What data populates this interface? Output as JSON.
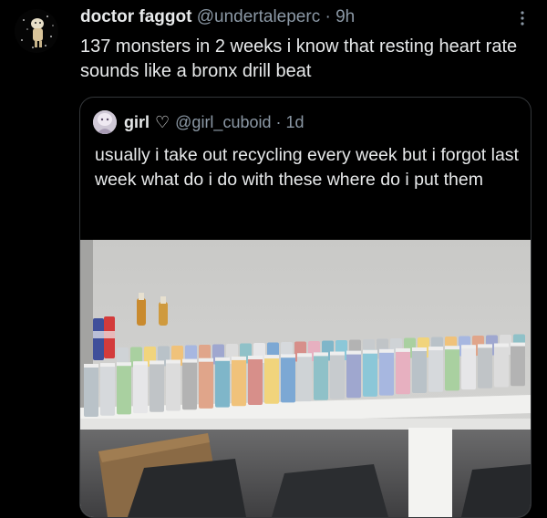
{
  "tweet": {
    "display_name": "doctor faggot",
    "handle": "@undertaleperc",
    "separator": "·",
    "time": "9h",
    "text": "137 monsters in 2 weeks i know that resting heart rate sounds like a bronx drill beat"
  },
  "quoted": {
    "display_name": "girl",
    "heart": "♡",
    "handle": "@girl_cuboid",
    "separator": "·",
    "time": "1d",
    "text": "usually i take out recycling every week but i forgot last week what do i do with these where do i put them"
  },
  "icons": {
    "more": "more-icon",
    "heart": "heart-icon"
  }
}
